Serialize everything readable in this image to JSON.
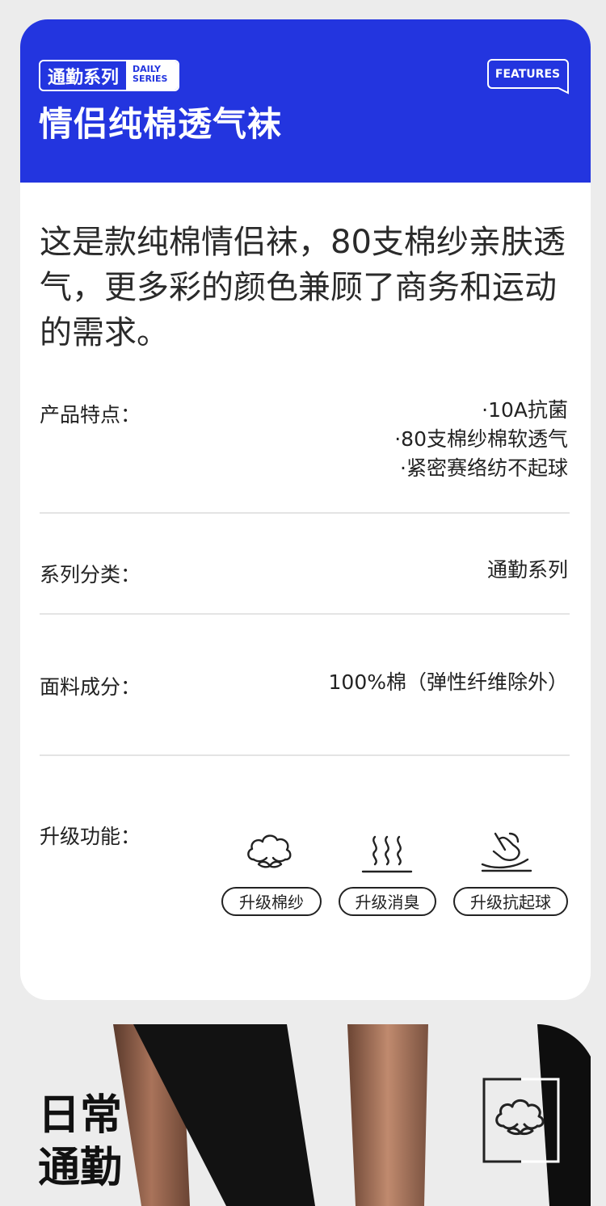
{
  "header": {
    "series_cn": "通勤系列",
    "series_en_1": "DAILY",
    "series_en_2": "SERIES",
    "features_label": "FEATURES",
    "title": "情侣纯棉透气袜"
  },
  "description": "这是款纯棉情侣袜，80支棉纱亲肤透气，更多彩的颜色兼顾了商务和运动的需求。",
  "specs": {
    "features_label": "产品特点：",
    "features_values": [
      "·10A抗菌",
      "·80支棉纱棉软透气",
      "·紧密赛络纺不起球"
    ],
    "series_label": "系列分类：",
    "series_value": "通勤系列",
    "material_label": "面料成分：",
    "material_value": "100%棉（弹性纤维除外）",
    "upgrade_label": "升级功能："
  },
  "upgrades": [
    {
      "icon": "cotton-icon",
      "label": "升级棉纱"
    },
    {
      "icon": "deodor-icon",
      "label": "升级消臭"
    },
    {
      "icon": "anti-pilling-icon",
      "label": "升级抗起球"
    }
  ],
  "bottom": {
    "line1": "日常",
    "line2": "通勤",
    "badge_icon": "cotton-icon"
  },
  "colors": {
    "brand_blue": "#2335df"
  }
}
